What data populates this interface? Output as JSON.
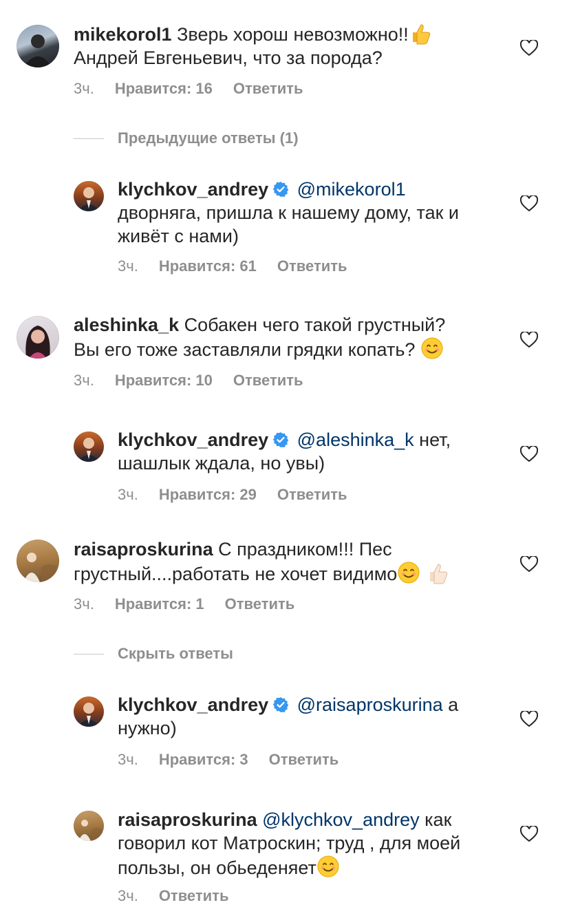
{
  "comments": [
    {
      "username": "mikekorol1",
      "mention": "",
      "text": "Зверь хорош невозможно!!",
      "text2": "Андрей Евгеньевич, что за порода?",
      "time": "3ч.",
      "likes": "Нравится: 16",
      "reply": "Ответить",
      "trailing_emoji": "thumbs-up-icon"
    },
    {
      "username": "klychkov_andrey",
      "verified": true,
      "mention": "@mikekorol1",
      "text": "дворняга, пришла к нашему дому, так и",
      "text2": "живёт с нами)",
      "time": "3ч.",
      "likes": "Нравится: 61",
      "reply": "Ответить"
    },
    {
      "username": "aleshinka_k",
      "text": "Собакен чего такой грустный?",
      "text2": "Вы его тоже заставляли грядки копать?",
      "time": "3ч.",
      "likes": "Нравится: 10",
      "reply": "Ответить",
      "trailing_emoji": "smiling-face-icon"
    },
    {
      "username": "klychkov_andrey",
      "verified": true,
      "mention": "@aleshinka_k",
      "text": "нет,",
      "text2": "шашлык ждала, но увы)",
      "time": "3ч.",
      "likes": "Нравится: 29",
      "reply": "Ответить"
    },
    {
      "username": "raisaproskurina",
      "text": "С праздником!!! Пес",
      "text2": "грустный....работать не хочет видимо",
      "time": "3ч.",
      "likes": "Нравится: 1",
      "reply": "Ответить",
      "trailing_emoji": "smiling-face-and-thumbs-up-icon"
    },
    {
      "username": "klychkov_andrey",
      "verified": true,
      "mention": "@raisaproskurina",
      "text": "а",
      "text2": "нужно)",
      "time": "3ч.",
      "likes": "Нравится: 3",
      "reply": "Ответить"
    },
    {
      "username": "raisaproskurina",
      "mention": "@klychkov_andrey",
      "text": "как",
      "text2": "говорил кот Матроскин; труд , для моей",
      "text3": "пользы, он обьеденяет",
      "time": "3ч.",
      "reply": "Ответить",
      "trailing_emoji": "smiling-face-icon"
    }
  ],
  "threads": {
    "previous": "Предыдущие ответы (1)",
    "hide": "Скрыть ответы"
  },
  "colors": {
    "text": "#262626",
    "muted": "#8e8e8e",
    "mention": "#003569",
    "verified": "#3897f0"
  }
}
